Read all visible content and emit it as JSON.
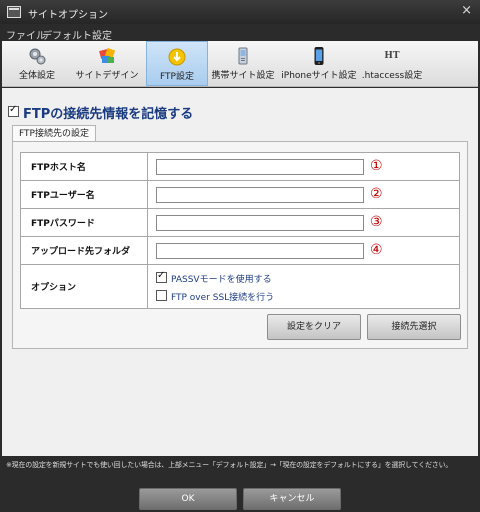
{
  "window": {
    "title": "サイトオプション",
    "close_glyph": "×"
  },
  "menu": {
    "items": [
      "ファイル",
      "デフォルト設定"
    ]
  },
  "toolbar": {
    "tabs": [
      {
        "label": "全体設定",
        "icon": "gears-icon"
      },
      {
        "label": "サイトデザイン",
        "icon": "design-icon"
      },
      {
        "label": "FTP設定",
        "icon": "ftp-icon",
        "active": true
      },
      {
        "label": "携帯サイト設定",
        "icon": "mobile-phone-icon"
      },
      {
        "label": "iPhoneサイト設定",
        "icon": "iphone-icon"
      },
      {
        "label": ".htaccess設定",
        "icon": "htaccess-icon",
        "icon_text": "HT"
      }
    ]
  },
  "remember": {
    "label": "FTPの接続先情報を記憶する",
    "checked": true
  },
  "section_tab": "FTP接続先の設定",
  "form": {
    "host": {
      "label": "FTPホスト名",
      "value": "",
      "marker": "①"
    },
    "user": {
      "label": "FTPユーザー名",
      "value": "",
      "marker": "②"
    },
    "password": {
      "label": "FTPパスワード",
      "value": "",
      "marker": "③"
    },
    "folder": {
      "label": "アップロード先フォルダ",
      "value": "",
      "marker": "④"
    },
    "options": {
      "label": "オプション",
      "passv": {
        "label": "PASSVモードを使用する",
        "checked": true
      },
      "ssl": {
        "label": "FTP over SSL接続を行う",
        "checked": false
      }
    }
  },
  "buttons": {
    "clear": "設定をクリア",
    "select": "接続先選択",
    "ok": "OK",
    "cancel": "キャンセル"
  },
  "footer_note": "※現在の設定を新規サイトでも使い回したい場合は、上部メニュー「デフォルト設定」→「現在の設定をデフォルトにする」を選択してください。",
  "colors": {
    "accent_text": "#1a3b80",
    "marker": "#c00000",
    "active_tab": "#a9cdef",
    "window_bg": "#2b2b2b"
  }
}
